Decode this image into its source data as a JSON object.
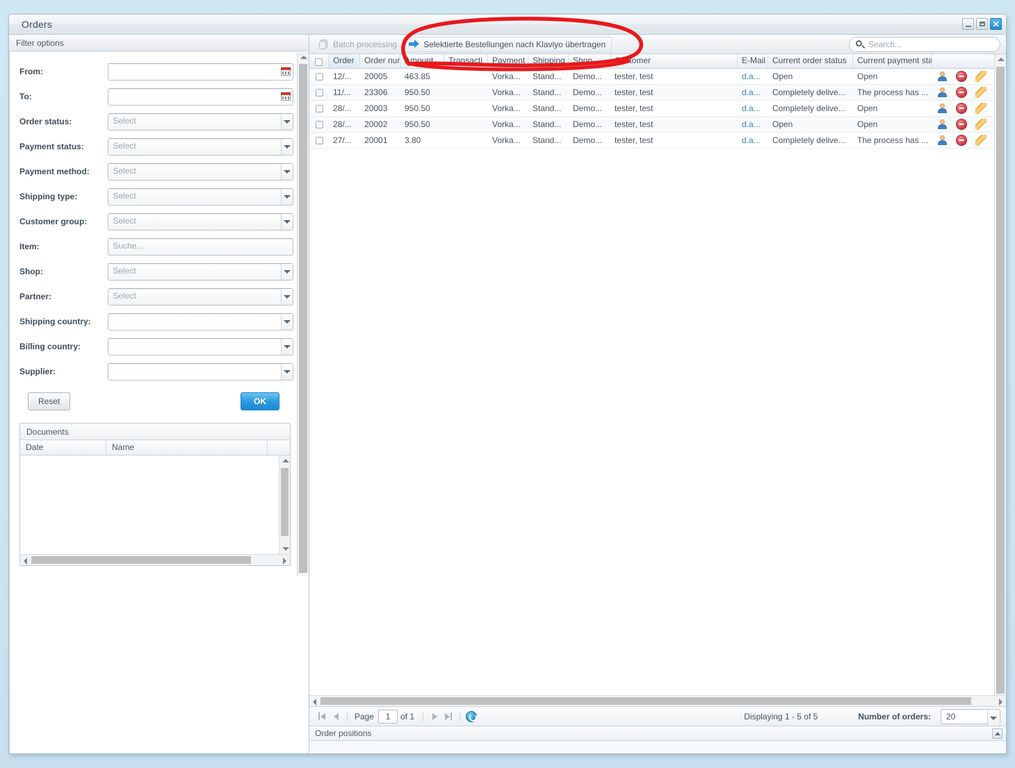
{
  "window": {
    "title": "Orders",
    "controls": {
      "minimize": "–",
      "maximize": "□",
      "close": "✕"
    }
  },
  "filter_panel": {
    "header": "Filter options",
    "fields": [
      {
        "label": "From:",
        "type": "date",
        "value": "",
        "placeholder": ""
      },
      {
        "label": "To:",
        "type": "date",
        "value": "",
        "placeholder": ""
      },
      {
        "label": "Order status:",
        "type": "select",
        "value": "",
        "placeholder": "Select"
      },
      {
        "label": "Payment status:",
        "type": "select",
        "value": "",
        "placeholder": "Select"
      },
      {
        "label": "Payment method:",
        "type": "select",
        "value": "",
        "placeholder": "Select"
      },
      {
        "label": "Shipping type:",
        "type": "select",
        "value": "",
        "placeholder": "Select"
      },
      {
        "label": "Customer group:",
        "type": "select",
        "value": "",
        "placeholder": "Select"
      },
      {
        "label": "Item:",
        "type": "text",
        "value": "",
        "placeholder": "Suche..."
      },
      {
        "label": "Shop:",
        "type": "select",
        "value": "",
        "placeholder": "Select"
      },
      {
        "label": "Partner:",
        "type": "select",
        "value": "",
        "placeholder": "Select"
      },
      {
        "label": "Shipping country:",
        "type": "select",
        "value": "",
        "placeholder": ""
      },
      {
        "label": "Billing country:",
        "type": "select",
        "value": "",
        "placeholder": ""
      },
      {
        "label": "Supplier:",
        "type": "select",
        "value": "",
        "placeholder": ""
      }
    ],
    "reset_label": "Reset",
    "ok_label": "OK"
  },
  "documents": {
    "header": "Documents",
    "columns": [
      "Date",
      "Name",
      ""
    ],
    "rows": []
  },
  "toolbar": {
    "batch_processing": "Batch processing",
    "klaviyo_transfer": "Selektierte Bestellungen nach Klaviyo übertragen",
    "search_placeholder": "Search..."
  },
  "grid": {
    "columns": [
      "Order ",
      "Order nur",
      "Amount",
      "Transacti",
      "Payment",
      "Shipping",
      "Shop",
      "Customer",
      "E-Mail",
      "Current order status",
      "Current payment stat"
    ],
    "rows": [
      {
        "date": "12/...",
        "order_number": "20005",
        "amount": "463.85",
        "transaction": "",
        "payment": "Vorka...",
        "shipping": "Stand...",
        "shop": "Demo...",
        "customer": "tester, test",
        "email": "d.a...",
        "order_status": "Open",
        "payment_status": "Open"
      },
      {
        "date": "11/...",
        "order_number": "23306",
        "amount": "950.50",
        "transaction": "",
        "payment": "Vorka...",
        "shipping": "Stand...",
        "shop": "Demo...",
        "customer": "tester, test",
        "email": "d.a...",
        "order_status": "Completely delive...",
        "payment_status": "The process has ..."
      },
      {
        "date": "28/...",
        "order_number": "20003",
        "amount": "950.50",
        "transaction": "",
        "payment": "Vorka...",
        "shipping": "Stand...",
        "shop": "Demo...",
        "customer": "tester, test",
        "email": "d.a...",
        "order_status": "Completely delive...",
        "payment_status": "Open"
      },
      {
        "date": "28/...",
        "order_number": "20002",
        "amount": "950.50",
        "transaction": "",
        "payment": "Vorka...",
        "shipping": "Stand...",
        "shop": "Demo...",
        "customer": "tester, test",
        "email": "d.a...",
        "order_status": "Open",
        "payment_status": "Open"
      },
      {
        "date": "27/...",
        "order_number": "20001",
        "amount": "3.80",
        "transaction": "",
        "payment": "Vorka...",
        "shipping": "Stand...",
        "shop": "Demo...",
        "customer": "tester, test",
        "email": "d.a...",
        "order_status": "Completely delive...",
        "payment_status": "The process has ..."
      }
    ]
  },
  "pager": {
    "page_label": "Page",
    "page_value": "1",
    "of_label": "of 1",
    "displaying": "Displaying 1 - 5 of 5",
    "number_of_orders_label": "Number of orders:",
    "number_of_orders_value": "20"
  },
  "order_positions": {
    "header": "Order positions"
  },
  "colors": {
    "accent": "#1d8ad3",
    "annotation": "#e8181c",
    "link": "#3b7fc4",
    "desktop": "#cfe4f1",
    "delete_icon": "#cc3344",
    "pencil_icon": "#e8a33d"
  }
}
